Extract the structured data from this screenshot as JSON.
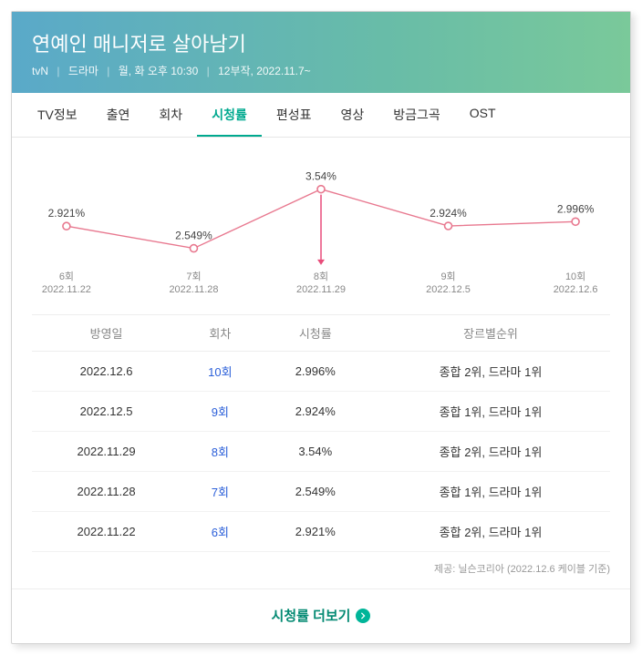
{
  "header": {
    "title": "연예인 매니저로 살아남기",
    "channel": "tvN",
    "genre": "드라마",
    "schedule": "월, 화 오후 10:30",
    "episodesInfo": "12부작, 2022.11.7~"
  },
  "tabs": [
    {
      "label": "TV정보"
    },
    {
      "label": "출연"
    },
    {
      "label": "회차"
    },
    {
      "label": "시청률",
      "active": true
    },
    {
      "label": "편성표"
    },
    {
      "label": "영상"
    },
    {
      "label": "방금그곡"
    },
    {
      "label": "OST"
    }
  ],
  "chart_data": {
    "type": "line",
    "title": "",
    "xlabel": "",
    "ylabel": "",
    "ylim": [
      2.3,
      3.7
    ],
    "highlight_index": 2,
    "x_points": [
      {
        "ep": "6회",
        "date": "2022.11.22"
      },
      {
        "ep": "7회",
        "date": "2022.11.28"
      },
      {
        "ep": "8회",
        "date": "2022.11.29"
      },
      {
        "ep": "9회",
        "date": "2022.12.5"
      },
      {
        "ep": "10회",
        "date": "2022.12.6"
      }
    ],
    "values": [
      2.921,
      2.549,
      3.54,
      2.924,
      2.996
    ],
    "value_labels": [
      "2.921%",
      "2.549%",
      "3.54%",
      "2.924%",
      "2.996%"
    ]
  },
  "table": {
    "columns": [
      "방영일",
      "회차",
      "시청률",
      "장르별순위"
    ],
    "rows": [
      {
        "date": "2022.12.6",
        "ep": "10회",
        "rating": "2.996%",
        "rank": "종합 2위, 드라마 1위"
      },
      {
        "date": "2022.12.5",
        "ep": "9회",
        "rating": "2.924%",
        "rank": "종합 1위, 드라마 1위"
      },
      {
        "date": "2022.11.29",
        "ep": "8회",
        "rating": "3.54%",
        "rank": "종합 2위, 드라마 1위"
      },
      {
        "date": "2022.11.28",
        "ep": "7회",
        "rating": "2.549%",
        "rank": "종합 1위, 드라마 1위"
      },
      {
        "date": "2022.11.22",
        "ep": "6회",
        "rating": "2.921%",
        "rank": "종합 2위, 드라마 1위"
      }
    ]
  },
  "source": "제공: 닐슨코리아 (2022.12.6 케이블 기준)",
  "more": {
    "label": "시청률 더보기"
  },
  "colors": {
    "accent": "#00a98f",
    "line": "#e8788f",
    "highlight": "#e84c7a"
  }
}
